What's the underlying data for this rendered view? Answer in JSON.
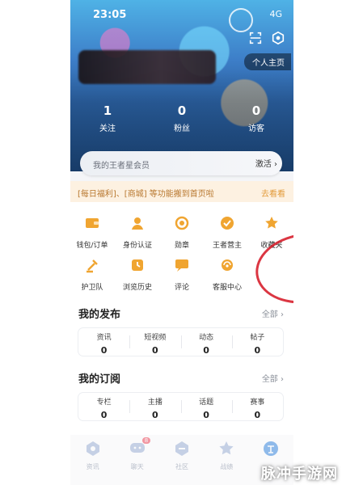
{
  "status": {
    "time": "23:05",
    "signal": "4G"
  },
  "hero": {
    "profile_button": "个人主页",
    "stats": [
      {
        "value": "1",
        "label": "关注"
      },
      {
        "value": "0",
        "label": "粉丝"
      },
      {
        "value": "0",
        "label": "访客"
      }
    ]
  },
  "vip": {
    "text": "我的王者星会员",
    "action": "激活 ›"
  },
  "notice": {
    "text": "[每日福利]、[商城] 等功能搬到首页啦",
    "link": "去看看"
  },
  "grid": [
    {
      "label": "钱包/订单",
      "icon": "wallet-icon"
    },
    {
      "label": "身份认证",
      "icon": "id-icon"
    },
    {
      "label": "勋章",
      "icon": "medal-icon"
    },
    {
      "label": "王者营主",
      "icon": "check-badge-icon"
    },
    {
      "label": "收藏夹",
      "icon": "star-icon"
    },
    {
      "label": "护卫队",
      "icon": "guard-icon"
    },
    {
      "label": "浏览历史",
      "icon": "history-icon"
    },
    {
      "label": "评论",
      "icon": "comment-icon"
    },
    {
      "label": "客服中心",
      "icon": "support-icon"
    }
  ],
  "my_posts": {
    "title": "我的发布",
    "more": "全部 ›",
    "items": [
      {
        "label": "资讯",
        "value": "0"
      },
      {
        "label": "短视频",
        "value": "0"
      },
      {
        "label": "动态",
        "value": "0"
      },
      {
        "label": "帖子",
        "value": "0"
      }
    ]
  },
  "my_subs": {
    "title": "我的订阅",
    "more": "全部 ›",
    "items": [
      {
        "label": "专栏",
        "value": "0"
      },
      {
        "label": "主播",
        "value": "0"
      },
      {
        "label": "话题",
        "value": "0"
      },
      {
        "label": "赛事",
        "value": "0"
      }
    ]
  },
  "tabbar": {
    "tabs": [
      {
        "label": "资讯",
        "icon": "news-icon"
      },
      {
        "label": "聊天",
        "icon": "chat-icon",
        "badge": "8"
      },
      {
        "label": "社区",
        "icon": "community-icon"
      },
      {
        "label": "战绩",
        "icon": "record-icon"
      },
      {
        "label": "",
        "icon": "celebrate-icon"
      }
    ]
  },
  "watermark": "脉冲手游网",
  "colors": {
    "accent": "#f0a531",
    "notice_bg": "#fdf1e1",
    "annotation": "#d7202e"
  }
}
